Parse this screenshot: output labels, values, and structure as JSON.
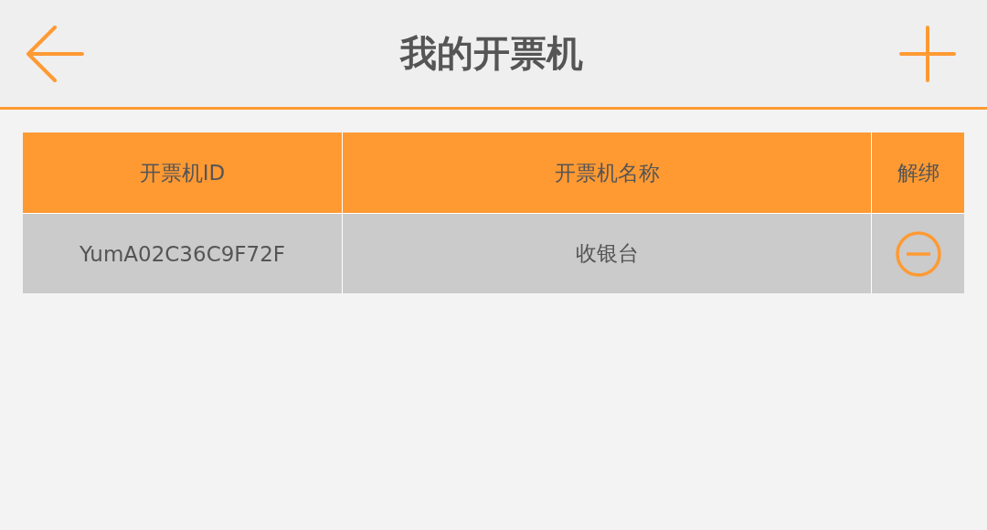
{
  "header": {
    "title": "我的开票机"
  },
  "table": {
    "columns": [
      "开票机ID",
      "开票机名称",
      "解绑"
    ],
    "rows": [
      {
        "id": "YumA02C36C9F72F",
        "name": "收银台"
      }
    ]
  }
}
